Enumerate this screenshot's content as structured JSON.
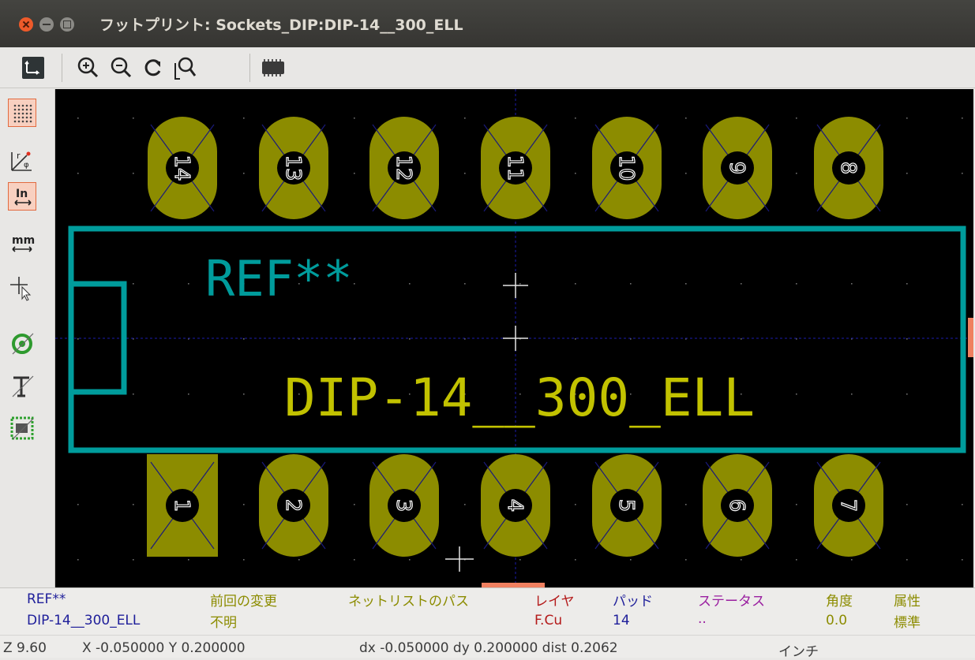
{
  "window": {
    "title": "フットプリント: Sockets_DIP:DIP-14__300_ELL"
  },
  "toolbar": {
    "items": [
      "board-setup-icon",
      "zoom-in-icon",
      "zoom-out-icon",
      "redraw-icon",
      "zoom-fit-icon",
      "footprint-icon"
    ]
  },
  "left_toolbar": {
    "items": [
      "grid-toggle-icon",
      "polar-coords-icon",
      "units-inch-icon",
      "units-mm-icon",
      "cursor-shape-icon",
      "pad-sketch-icon",
      "text-sketch-icon",
      "edge-sketch-icon"
    ],
    "inch_label": "In",
    "mm_label": "mm"
  },
  "canvas": {
    "ref_text": "REF**",
    "value_text": "DIP-14__300_ELL",
    "top_pads": [
      "14",
      "13",
      "12",
      "11",
      "10",
      "9",
      "8"
    ],
    "bottom_pads": [
      "1",
      "2",
      "3",
      "4",
      "5",
      "6",
      "7"
    ],
    "colors": {
      "background": "#000000",
      "pad": "#8c8c00",
      "silkscreen": "#009c9c",
      "value_text": "#c2c200",
      "grid": "#6f6f6f",
      "axis": "#1d1dab"
    }
  },
  "message_panel": {
    "ref_value": "REF**",
    "footprint_name": "DIP-14__300_ELL",
    "last_change": {
      "label": "前回の変更",
      "value": "不明"
    },
    "netlist_path": {
      "label": "ネットリストのパス",
      "value": ""
    },
    "layer": {
      "label": "レイヤ",
      "value": "F.Cu"
    },
    "pads": {
      "label": "パッド",
      "value": "14"
    },
    "status": {
      "label": "ステータス",
      "value": ".."
    },
    "angle": {
      "label": "角度",
      "value": "0.0"
    },
    "attributes": {
      "label": "属性",
      "value": "標準"
    }
  },
  "status_bar": {
    "zoom": "Z 9.60",
    "xy": "X -0.050000  Y 0.200000",
    "delta": "dx -0.050000  dy 0.200000  dist 0.2062",
    "units": "インチ"
  }
}
